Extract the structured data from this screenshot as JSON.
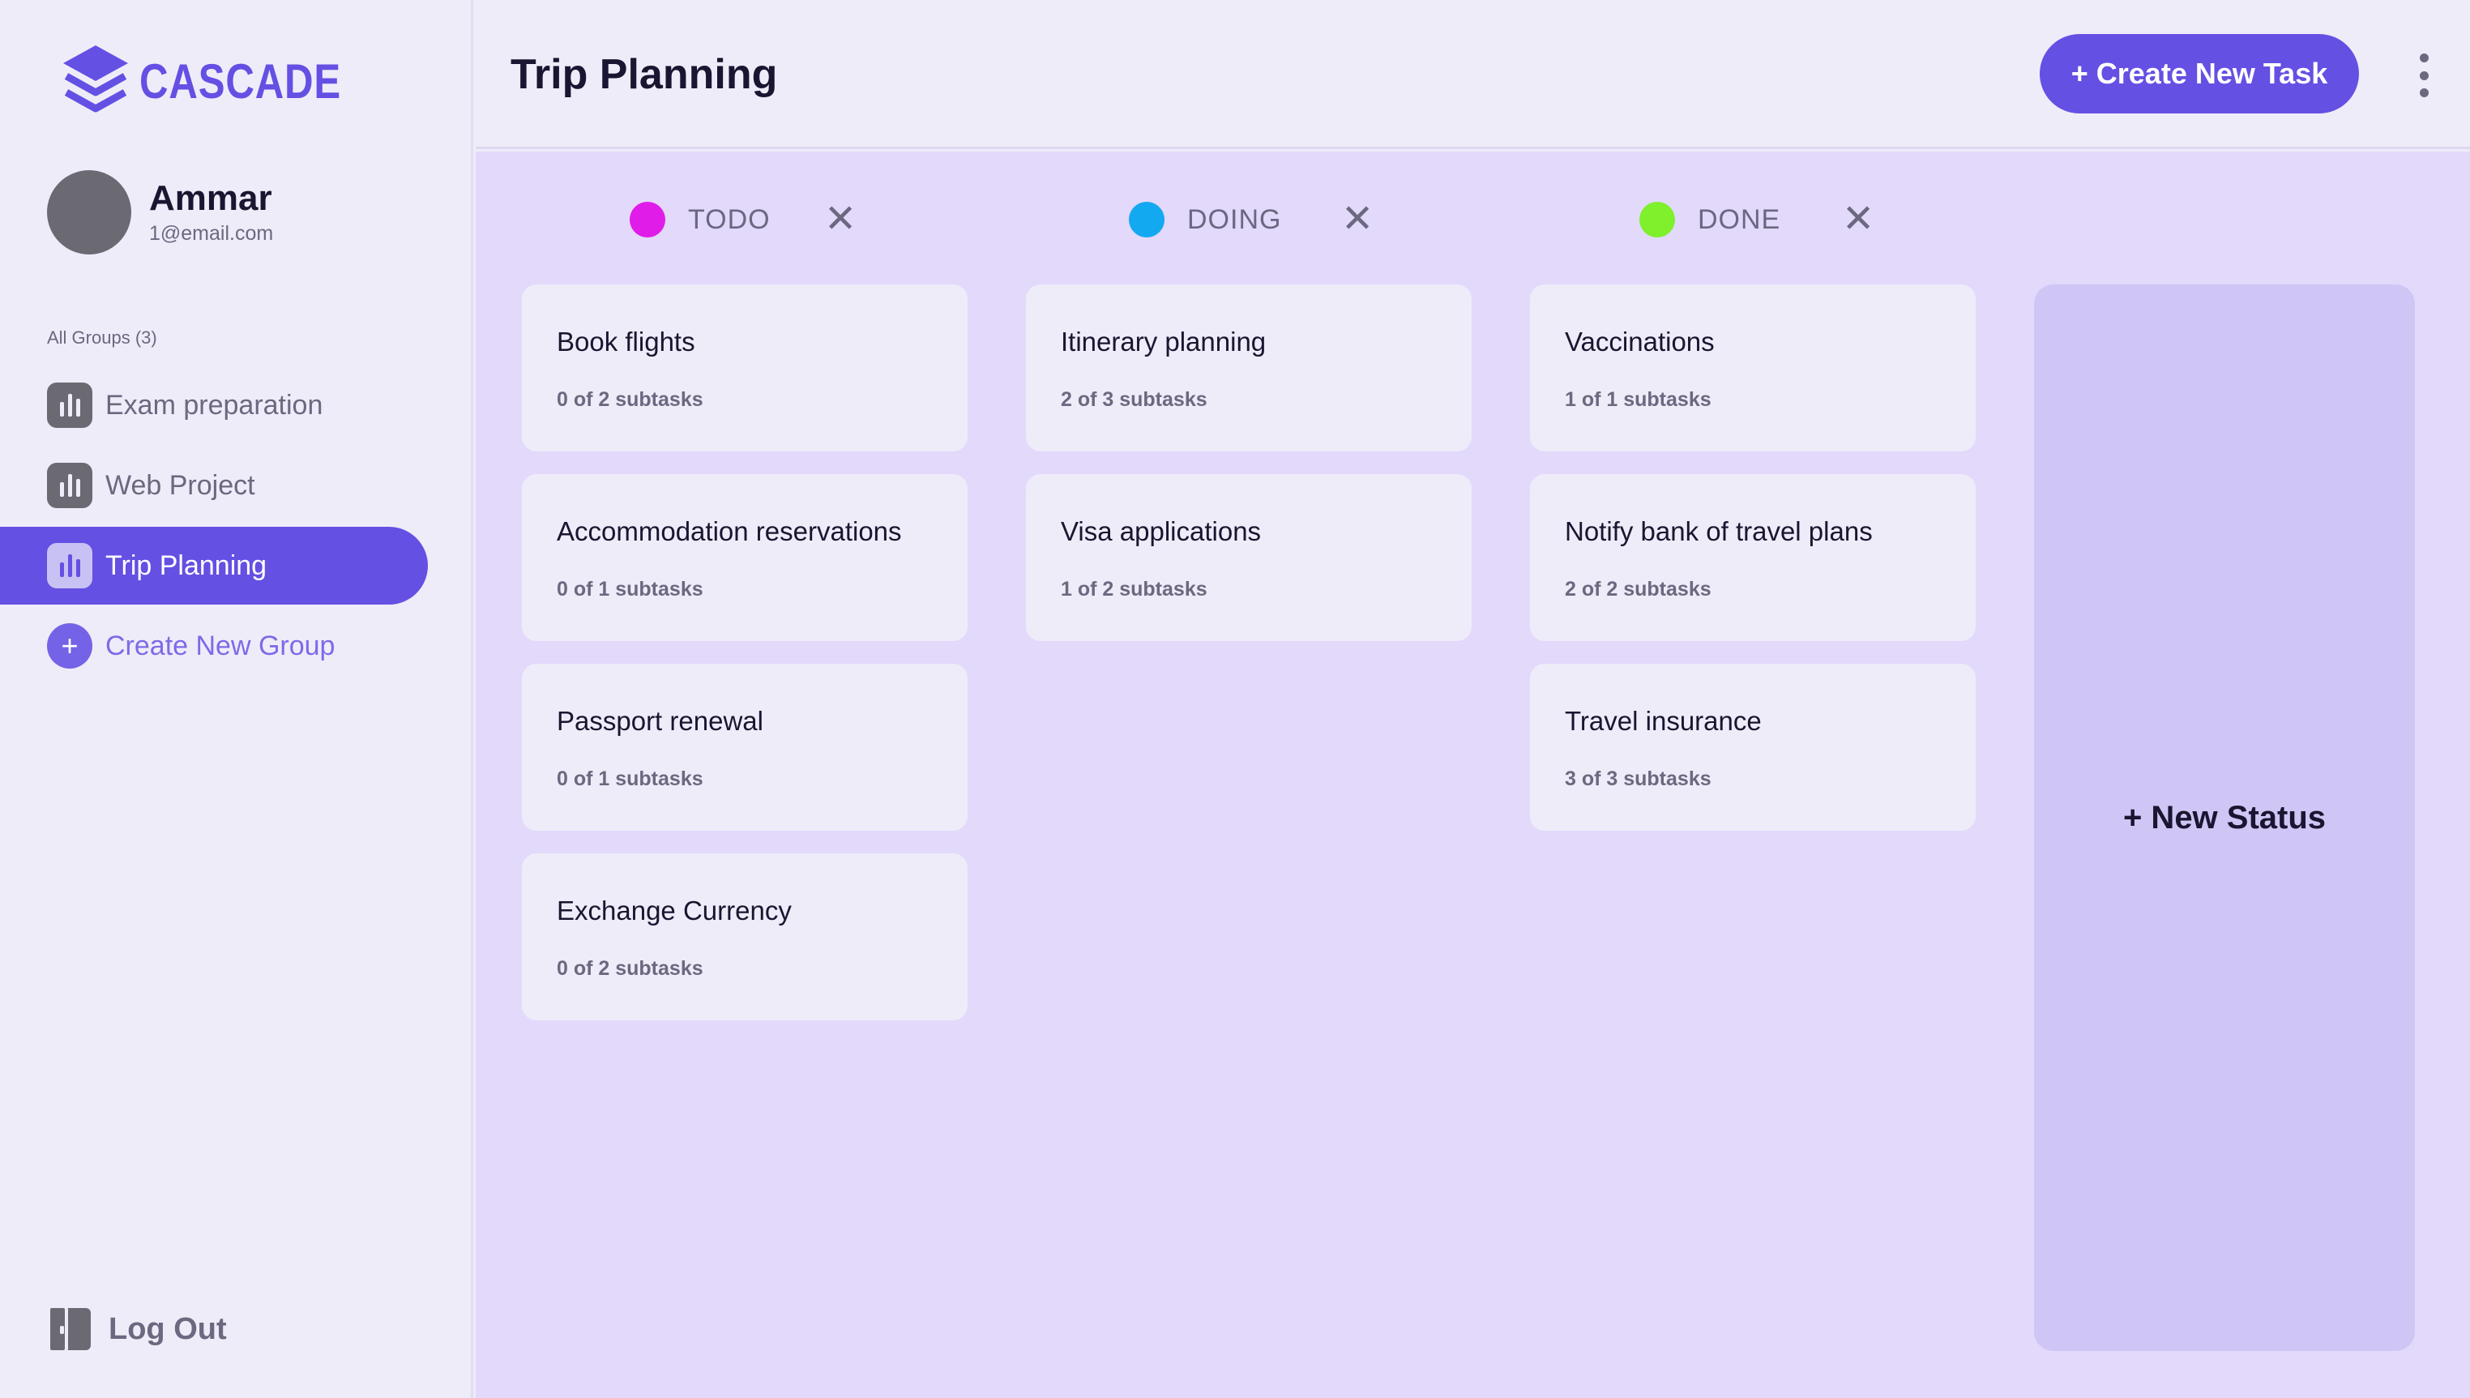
{
  "app": {
    "name": "CASCADE",
    "brand_color": "#6450e3"
  },
  "user": {
    "name": "Ammar",
    "email": "1@email.com"
  },
  "sidebar": {
    "groups_label": "All Groups (3)",
    "items": [
      {
        "label": "Exam preparation",
        "icon": "chart-bars-icon",
        "active": false
      },
      {
        "label": "Web Project",
        "icon": "chart-bars-icon",
        "active": false
      },
      {
        "label": "Trip Planning",
        "icon": "chart-bars-icon",
        "active": true
      }
    ],
    "create_group": "Create New Group",
    "logout": "Log Out"
  },
  "header": {
    "title": "Trip Planning",
    "create_task": "+ Create New Task"
  },
  "columns": [
    {
      "name": "TODO",
      "color": "#e01ce8",
      "tasks": [
        {
          "title": "Book flights",
          "subtasks": "0 of 2 subtasks"
        },
        {
          "title": "Accommodation reservations",
          "subtasks": "0 of 1 subtasks"
        },
        {
          "title": "Passport renewal",
          "subtasks": "0 of 1 subtasks"
        },
        {
          "title": "Exchange Currency",
          "subtasks": "0 of 2 subtasks"
        }
      ]
    },
    {
      "name": "DOING",
      "color": "#13a9f0",
      "tasks": [
        {
          "title": "Itinerary planning",
          "subtasks": "2 of 3 subtasks"
        },
        {
          "title": "Visa applications",
          "subtasks": "1 of 2 subtasks"
        }
      ]
    },
    {
      "name": "DONE",
      "color": "#7ef02c",
      "tasks": [
        {
          "title": "Vaccinations",
          "subtasks": "1 of 1 subtasks"
        },
        {
          "title": "Notify bank of travel plans",
          "subtasks": "2 of 2 subtasks"
        },
        {
          "title": "Travel insurance",
          "subtasks": "3 of 3 subtasks"
        }
      ]
    }
  ],
  "new_status": "+ New Status"
}
